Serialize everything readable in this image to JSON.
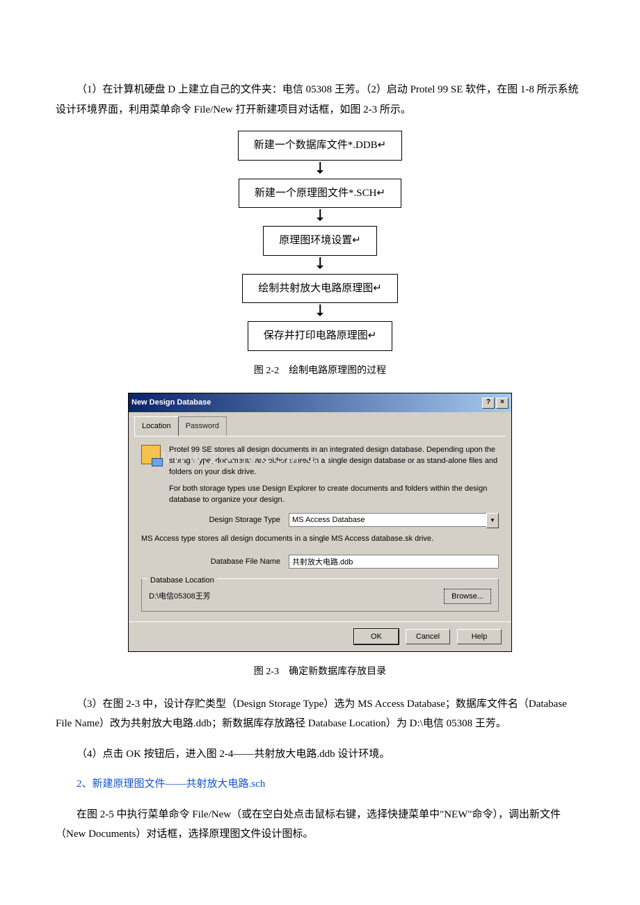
{
  "para1": "（1）在计算机硬盘 D 上建立自己的文件夹：电信 05308 王芳。（2）启动 Protel 99 SE 软件，在图 1-8 所示系统设计环境界面，利用菜单命令 File/New 打开新建项目对话框，如图 2-3 所示。",
  "flow": {
    "s1": "新建一个数据库文件*.DDB↵",
    "s2": "新建一个原理图文件*.SCH↵",
    "s3": "原理图环境设置↵",
    "s4": "绘制共射放大电路原理图↵",
    "s5": "保存并打印电路原理图↵"
  },
  "caption1": "图 2-2　绘制电路原理图的过程",
  "dialog": {
    "title": "New Design Database",
    "help_btn": "?",
    "close_btn": "×",
    "tab1": "Location",
    "tab2": "Password",
    "desc1": "Protel 99 SE stores all design documents in an integrated design database. Depending upon the storage type, documents are either stored in a single design database or as stand-alone files and folders on your disk drive.",
    "desc2": "For both storage types use Design Explorer to create documents and folders within the design database to organize your design.",
    "storage_label": "Design Storage Type",
    "storage_value": "MS Access Database",
    "storage_note": "MS Access type stores all design documents in a single MS Access database.sk drive.",
    "file_label": "Database File Name",
    "file_value": "共射放大电路.ddb",
    "group_label": "Database Location",
    "location_path": "D:\\电信05308王芳",
    "browse": "Browse...",
    "ok": "OK",
    "cancel": "Cancel",
    "help": "Help"
  },
  "caption2": "图 2-3　确定新数据库存放目录",
  "para3": "（3）在图 2-3 中，设计存贮类型（Design Storage Type）选为 MS Access Database；数据库文件名（Database File Name）改为共射放大电路.ddb；新数据库存放路径 Database Location）为 D:\\电信 05308 王芳。",
  "para4": "（4）点击 OK 按钮后，进入图 2-4——共射放大电路.ddb 设计环境。",
  "heading2": "2、新建原理图文件——共射放大电路.sch",
  "para5": "在图 2-5 中执行菜单命令 File/New（或在空白处点击鼠标右键，选择快捷菜单中\"NEW\"命令），调出新文件（New Documents）对话框，选择原理图文件设计图标。",
  "watermark": "WWW.ZIXIN.COM.CN"
}
